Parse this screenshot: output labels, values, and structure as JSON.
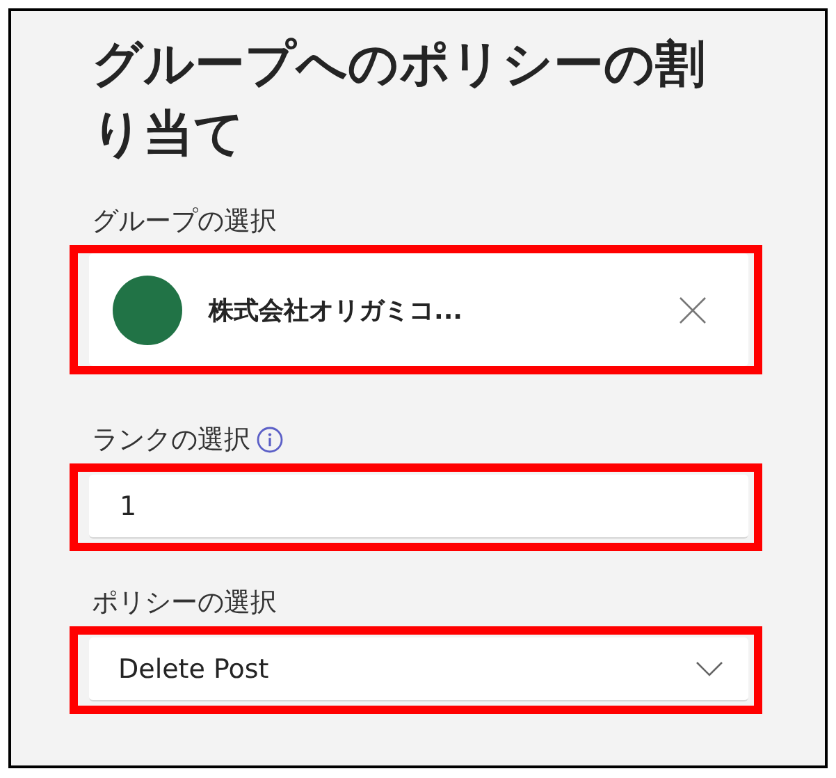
{
  "title": "グループへのポリシーの割り当て",
  "group_field": {
    "label": "グループの選択",
    "value": "株式会社オリガミコ...",
    "highlighted": true
  },
  "rank_field": {
    "label": "ランクの選択",
    "value": "1",
    "highlighted": true
  },
  "policy_field": {
    "label": "ポリシーの選択",
    "value": "Delete Post",
    "highlighted": true
  }
}
